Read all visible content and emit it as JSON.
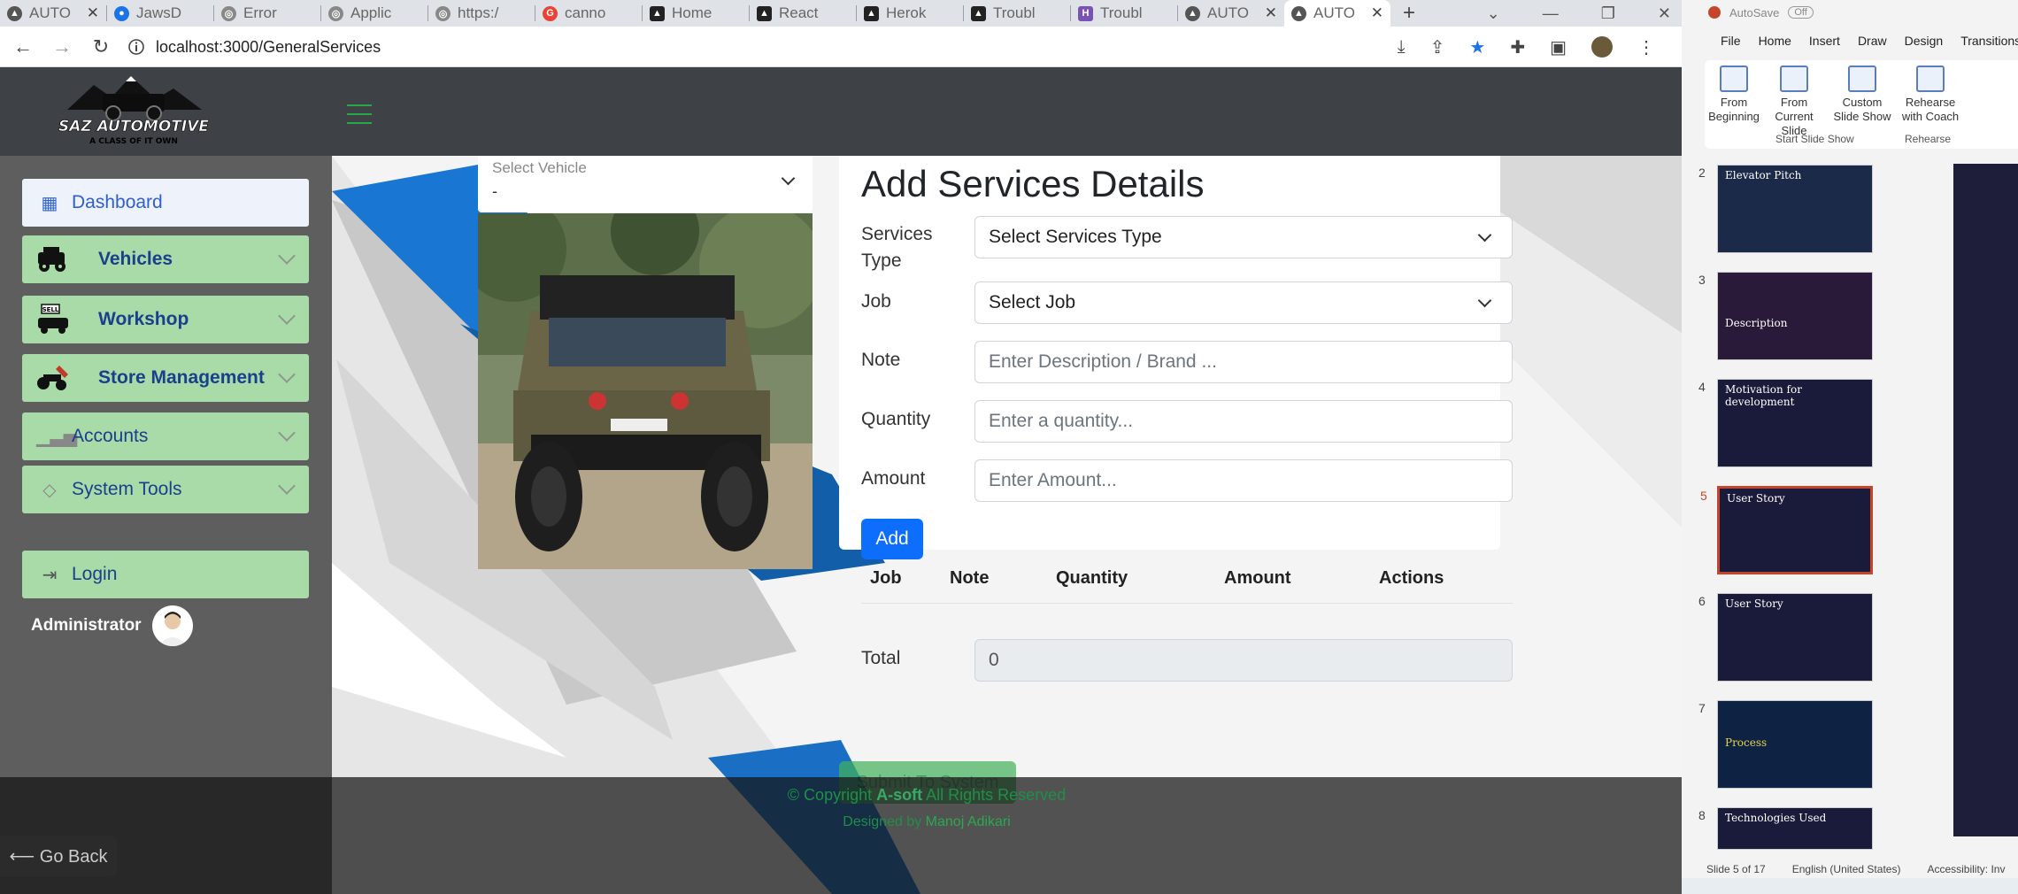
{
  "browser": {
    "tabs": [
      {
        "title": "AUTO",
        "color": "#555"
      },
      {
        "title": "JawsD",
        "color": "#1a73e8"
      },
      {
        "title": "Error",
        "color": "#555"
      },
      {
        "title": "Applic",
        "color": "#555"
      },
      {
        "title": "https:/",
        "color": "#555"
      },
      {
        "title": "canno",
        "color": "#ea4335"
      },
      {
        "title": "Home",
        "color": "#222"
      },
      {
        "title": "React",
        "color": "#222"
      },
      {
        "title": "Herok",
        "color": "#222"
      },
      {
        "title": "Troubl",
        "color": "#222"
      },
      {
        "title": "Troubl",
        "color": "#7952b3"
      },
      {
        "title": "AUTO",
        "color": "#555"
      },
      {
        "title": "AUTO",
        "color": "#555"
      }
    ],
    "url": "localhost:3000/GeneralServices"
  },
  "app": {
    "logo_text": "SAZ AUTOMOTIVE",
    "logo_tagline": "A CLASS OF IT OWN",
    "sidebar": {
      "items": [
        {
          "label": "Dashboard"
        },
        {
          "label": "Vehicles"
        },
        {
          "label": "Workshop"
        },
        {
          "label": "Store Management"
        },
        {
          "label": "Accounts"
        },
        {
          "label": "System Tools"
        },
        {
          "label": "Login"
        }
      ],
      "user": "Administrator"
    },
    "vehicle_select": {
      "label": "Select Vehicle",
      "value": "-"
    },
    "form": {
      "title": "Add Services Details",
      "services_type_label": "Services Type",
      "services_type_value": "Select Services Type",
      "job_label": "Job",
      "job_value": "Select Job",
      "note_label": "Note",
      "note_placeholder": "Enter Description / Brand ...",
      "quantity_label": "Quantity",
      "quantity_placeholder": "Enter a quantity...",
      "amount_label": "Amount",
      "amount_placeholder": "Enter Amount...",
      "add_button": "Add",
      "table_headers": [
        "Job",
        "Note",
        "Quantity",
        "Amount",
        "Actions"
      ],
      "total_label": "Total",
      "total_value": "0"
    },
    "submit_button": "Submit To System",
    "footer": {
      "copyright_prefix": "© Copyright",
      "company": "A-soft",
      "rights": "All Rights Reserved",
      "designed_prefix": "Designed by",
      "designer": "Manoj Adikari"
    },
    "go_back": "⟵ Go Back"
  },
  "powerpoint": {
    "autosave": "AutoSave",
    "autosave_state": "Off",
    "menu": [
      "File",
      "Home",
      "Insert",
      "Draw",
      "Design",
      "Transitions"
    ],
    "ribbon": [
      {
        "label": "From Beginning"
      },
      {
        "label": "From Current Slide"
      },
      {
        "label": "Custom Slide Show"
      },
      {
        "label": "Rehearse with Coach"
      }
    ],
    "group_start": "Start Slide Show",
    "group_rehearse": "Rehearse",
    "slides": [
      {
        "num": "2",
        "title": "Elevator Pitch"
      },
      {
        "num": "3",
        "title": "Description"
      },
      {
        "num": "4",
        "title": "Motivation for development"
      },
      {
        "num": "5",
        "title": "User Story"
      },
      {
        "num": "6",
        "title": "User Story"
      },
      {
        "num": "7",
        "title": "Process"
      },
      {
        "num": "8",
        "title": "Technologies Used"
      }
    ],
    "status": {
      "slide": "Slide 5 of 17",
      "language": "English (United States)",
      "accessibility": "Accessibility: Inv"
    }
  }
}
